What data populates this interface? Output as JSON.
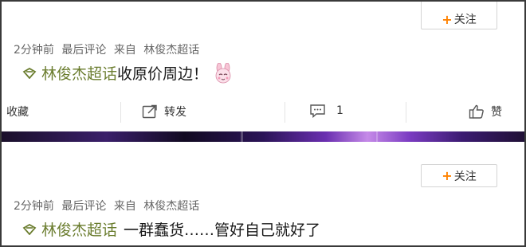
{
  "posts": [
    {
      "follow_label": "关注",
      "meta": {
        "time": "2分钟前",
        "sort": "最后评论",
        "source_prefix": "来自",
        "source": "林俊杰超话"
      },
      "topic": "林俊杰超话",
      "text": "收原价周边！",
      "emoji": "bunny-emoji",
      "actions": {
        "favorite": "收藏",
        "forward": "转发",
        "comment_count": "1",
        "like": "赞"
      }
    },
    {
      "follow_label": "关注",
      "meta": {
        "time": "2分钟前",
        "sort": "最后评论",
        "source_prefix": "来自",
        "source": "林俊杰超话"
      },
      "topic": "林俊杰超话",
      "text": "一群蠢货……管好自己就好了"
    }
  ],
  "colors": {
    "accent_plus": "#ff8200",
    "topic_link": "#6b7d2f",
    "banner": "#6a2fb0"
  }
}
